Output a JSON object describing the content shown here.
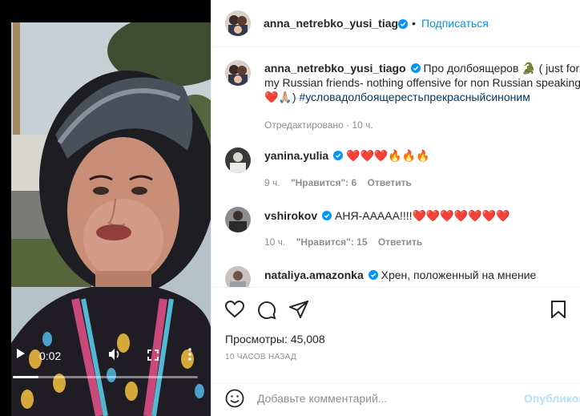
{
  "post": {
    "author": "anna_netrebko_yusi_tiago",
    "follow_label": "Подписаться",
    "separator": "•",
    "caption_author": "anna_netrebko_yusi_tiago",
    "caption_line1": " Про долбоящеров 🐊 ( just for",
    "caption_line2": "my Russian friends- nothing offensive for non Russian speaking",
    "caption_line3": "❤️🙏🏼) #условадолбоящерестьпрекрасныйсиноним",
    "caption_meta": "Отредактировано · 10 ч."
  },
  "comments": [
    {
      "user": "yanina.yulia",
      "text": "❤️❤️❤️🔥🔥🔥",
      "time": "9 ч.",
      "likes": "\"Нравится\": 6",
      "reply": "Ответить"
    },
    {
      "user": "vshirokov",
      "text": "АНЯ-ААААА!!!!❤️❤️❤️❤️❤️❤️❤️",
      "time": "10 ч.",
      "likes": "\"Нравится\": 15",
      "reply": "Ответить"
    },
    {
      "user": "nataliya.amazonka",
      "text": "Хрен, положенный на мнение"
    }
  ],
  "video": {
    "time": "0:02",
    "progress": 0.14
  },
  "stats": {
    "views": "Просмотры: 45,008",
    "ago": "10 ЧАСОВ НАЗАД"
  },
  "composer": {
    "placeholder": "Добавьте комментарий...",
    "publish": "Опубликовать"
  },
  "colors": {
    "link": "#0095f6",
    "verified": "#0095f6",
    "muted": "#8e8e8e"
  }
}
